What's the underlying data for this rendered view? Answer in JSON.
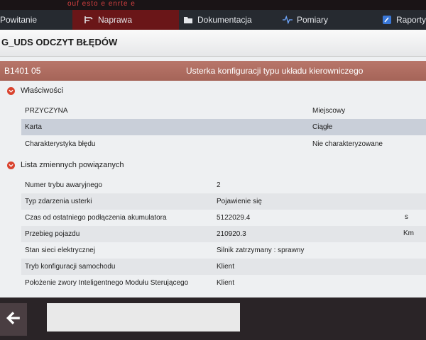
{
  "topbar": {
    "text": "ouf esto e enrte e"
  },
  "nav": {
    "items": [
      {
        "label": "Powitanie",
        "icon": ""
      },
      {
        "label": "Naprawa",
        "icon": "tools-icon"
      },
      {
        "label": "Dokumentacja",
        "icon": "folder-icon"
      },
      {
        "label": "Pomiary",
        "icon": "waveform-icon"
      },
      {
        "label": "Raporty",
        "icon": "report-icon"
      }
    ],
    "active_index": 1
  },
  "page": {
    "title": "G_UDS ODCZYT BŁĘDÓW"
  },
  "fault": {
    "code": "B1401 05",
    "description": "Usterka konfiguracji typu układu kierowniczego"
  },
  "properties": {
    "heading": "Właściwości",
    "rows": [
      {
        "label": "PRZYCZYNA",
        "value": "Miejscowy"
      },
      {
        "label": "Karta",
        "value": "Ciągłe"
      },
      {
        "label": "Charakterystyka błędu",
        "value": "Nie charakteryzowane"
      }
    ]
  },
  "variables": {
    "heading": "Lista zmiennych powiązanych",
    "rows": [
      {
        "label": "Numer trybu awaryjnego",
        "value": "2",
        "unit": ""
      },
      {
        "label": "Typ zdarzenia usterki",
        "value": "Pojawienie się",
        "unit": ""
      },
      {
        "label": "Czas od ostatniego podłączenia akumulatora",
        "value": "5122029.4",
        "unit": "s"
      },
      {
        "label": "Przebieg pojazdu",
        "value": "210920.3",
        "unit": "Km"
      },
      {
        "label": "Stan sieci elektrycznej",
        "value": "Silnik zatrzymany : sprawny",
        "unit": ""
      },
      {
        "label": "Tryb konfiguracji samochodu",
        "value": "Klient",
        "unit": ""
      },
      {
        "label": "Położenie zwory Inteligentnego Modułu Sterującego",
        "value": "Klient",
        "unit": ""
      }
    ]
  },
  "colors": {
    "accent": "#6a1618",
    "fault_bar": "#a56458",
    "highlight": "#c9cfd9",
    "dot": "#d9432f"
  }
}
